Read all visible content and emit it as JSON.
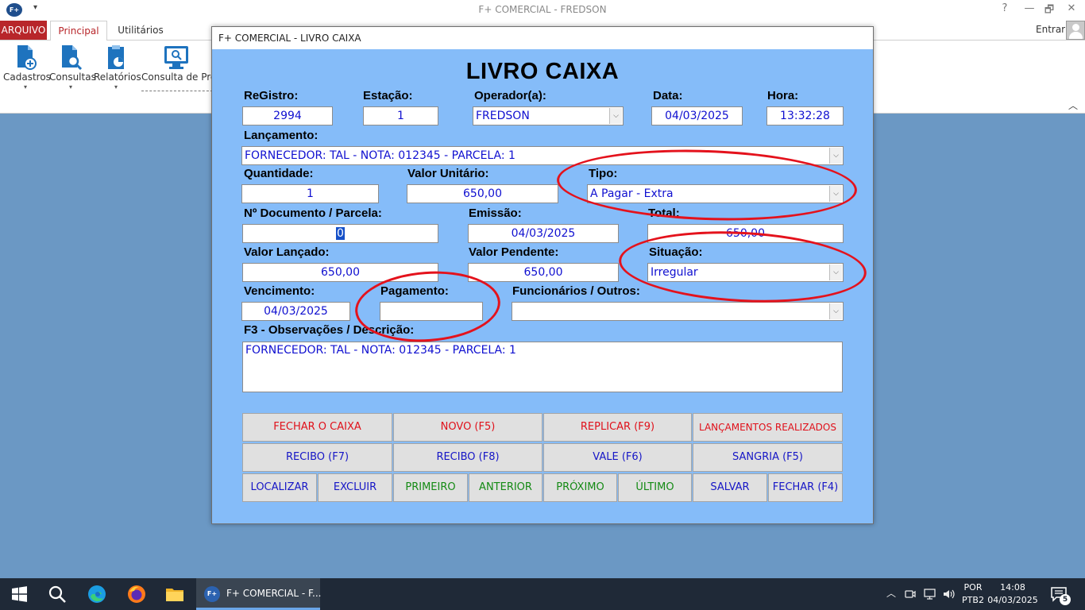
{
  "app": {
    "logo": "F+",
    "title": "F+ COMERCIAL - FREDSON",
    "controls": {
      "help": "?",
      "minimize": "—",
      "restore": "🗗",
      "close": "✕"
    }
  },
  "ribbon": {
    "tabs": {
      "arquivo": "ARQUIVO",
      "principal": "Principal",
      "utilitarios": "Utilitários"
    },
    "entrar": "Entrar",
    "buttons": {
      "cadastros": "Cadastros",
      "consultas": "Consultas",
      "relatorios": "Relatórios",
      "consulta_precos": "Consulta de Preços"
    },
    "caret": "▾",
    "collapse": "︿"
  },
  "dialog": {
    "window_title": "F+ COMERCIAL - LIVRO CAIXA",
    "heading": "LIVRO CAIXA",
    "labels": {
      "registro": "ReGistro:",
      "estacao": "Estação:",
      "operador": "Operador(a):",
      "data": "Data:",
      "hora": "Hora:",
      "lancamento": "Lançamento:",
      "quantidade": "Quantidade:",
      "valor_unitario": "Valor Unitário:",
      "tipo": "Tipo:",
      "documento": "Nº Documento / Parcela:",
      "emissao": "Emissão:",
      "total": "Total:",
      "valor_lancado": "Valor Lançado:",
      "valor_pendente": "Valor Pendente:",
      "situacao": "Situação:",
      "vencimento": "Vencimento:",
      "pagamento": "Pagamento:",
      "funcionarios": "Funcionários / Outros:",
      "observacoes": "F3 - Observações / Descrição:"
    },
    "values": {
      "registro": "2994",
      "estacao": "1",
      "operador": "FREDSON",
      "data": "04/03/2025",
      "hora": "13:32:28",
      "lancamento": "FORNECEDOR: TAL - NOTA: 012345 - PARCELA: 1",
      "quantidade": "1",
      "valor_unitario": "650,00",
      "tipo": "A Pagar - Extra",
      "documento": "0",
      "emissao": "04/03/2025",
      "total": "650,00",
      "valor_lancado": "650,00",
      "valor_pendente": "650,00",
      "situacao": "Irregular",
      "vencimento": "04/03/2025",
      "pagamento": "",
      "funcionarios": "",
      "observacoes": "FORNECEDOR: TAL - NOTA: 012345 - PARCELA: 1"
    },
    "dropdown_glyph": "⌵",
    "buttons": {
      "fechar_caixa": "FECHAR O CAIXA",
      "novo": "NOVO (F5)",
      "replicar": "REPLICAR (F9)",
      "lancamentos": "LANÇAMENTOS REALIZADOS",
      "recibo_f7": "RECIBO (F7)",
      "recibo_f8": "RECIBO (F8)",
      "vale": "VALE (F6)",
      "sangria": "SANGRIA (F5)",
      "localizar": "LOCALIZAR",
      "excluir": "EXCLUIR",
      "primeiro": "PRIMEIRO",
      "anterior": "ANTERIOR",
      "proximo": "PRÓXIMO",
      "ultimo": "ÚLTIMO",
      "salvar": "SALVAR",
      "fechar": "FECHAR (F4)"
    },
    "highlight_color": "#e4121c"
  },
  "taskbar": {
    "active_app": "F+ COMERCIAL - F...",
    "active_app_logo": "F+",
    "language": {
      "line1": "POR",
      "line2": "PTB2"
    },
    "time": "14:08",
    "date": "04/03/2025",
    "notification_count": "5"
  }
}
